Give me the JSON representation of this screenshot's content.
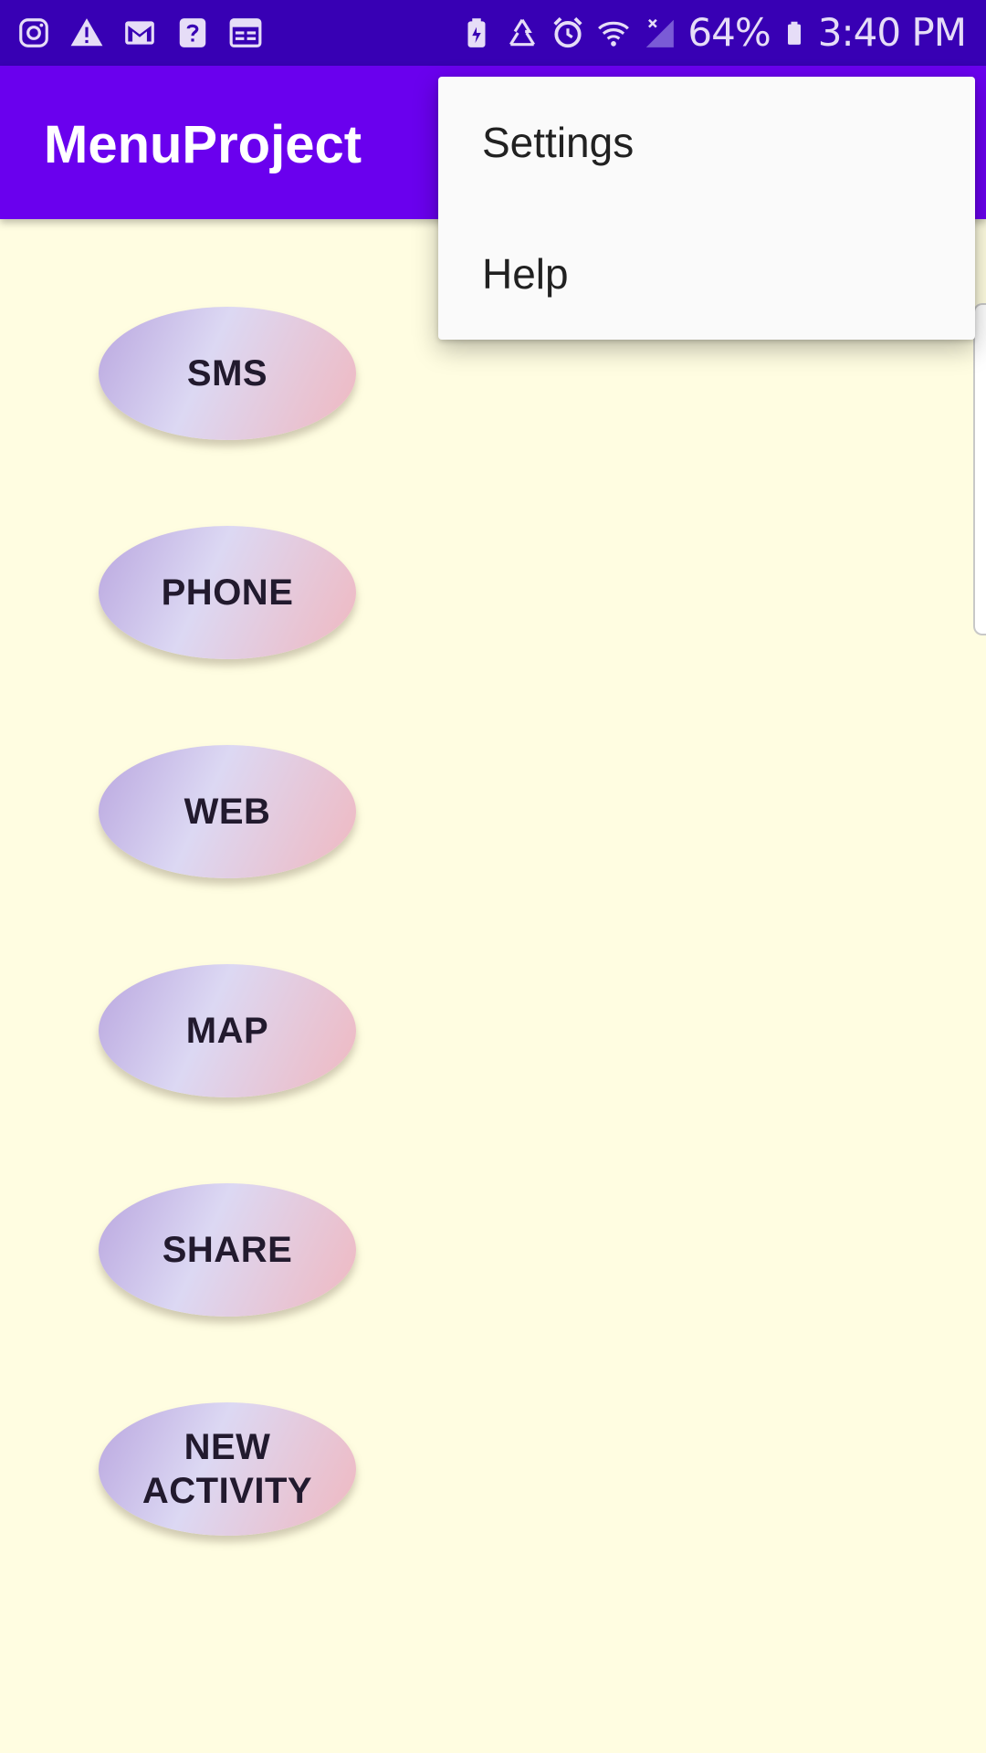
{
  "status_bar": {
    "battery": "64%",
    "time": "3:40 PM",
    "left_icons": [
      "instagram-icon",
      "warning-icon",
      "gmail-icon",
      "help-icon",
      "calendar-icon"
    ],
    "right_icons": [
      "battery-saver-icon",
      "recycle-icon",
      "alarm-icon",
      "wifi-icon",
      "signal-icon",
      "battery-icon"
    ]
  },
  "app_bar": {
    "title": "MenuProject"
  },
  "buttons": [
    {
      "label": "SMS"
    },
    {
      "label": "PHONE"
    },
    {
      "label": "WEB"
    },
    {
      "label": "MAP"
    },
    {
      "label": "SHARE"
    },
    {
      "label": "NEW\nACTIVITY"
    }
  ],
  "overflow_menu": {
    "items": [
      {
        "label": "Settings"
      },
      {
        "label": "Help"
      }
    ]
  },
  "colors": {
    "status_bar": "#3800B4",
    "app_bar": "#6A00EE",
    "background": "#FFFDE1",
    "menu_background": "#FAFAFA"
  }
}
